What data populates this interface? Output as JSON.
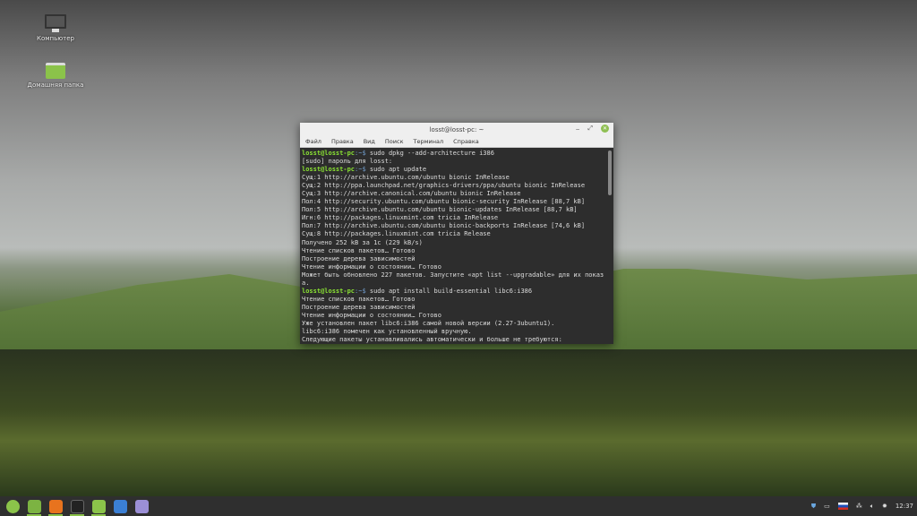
{
  "desktop": {
    "icons": [
      {
        "label": "Компьютер",
        "icon": "computer-icon"
      },
      {
        "label": "Домашняя папка",
        "icon": "home-folder-icon"
      }
    ]
  },
  "terminal": {
    "title": "losst@losst-pc: ~",
    "menu": [
      "Файл",
      "Правка",
      "Вид",
      "Поиск",
      "Терминал",
      "Справка"
    ],
    "lines": [
      {
        "prompt": "losst@losst-pc",
        "path": ":~$ ",
        "text": "sudo dpkg --add-architecture i386"
      },
      {
        "text": "[sudo] пароль для losst:"
      },
      {
        "prompt": "losst@losst-pc",
        "path": ":~$ ",
        "text": "sudo apt update"
      },
      {
        "text": "Сущ:1 http://archive.ubuntu.com/ubuntu bionic InRelease"
      },
      {
        "text": "Сущ:2 http://ppa.launchpad.net/graphics-drivers/ppa/ubuntu bionic InRelease"
      },
      {
        "text": "Сущ:3 http://archive.canonical.com/ubuntu bionic InRelease"
      },
      {
        "text": "Пол:4 http://security.ubuntu.com/ubuntu bionic-security InRelease [88,7 kB]"
      },
      {
        "text": "Пол:5 http://archive.ubuntu.com/ubuntu bionic-updates InRelease [88,7 kB]"
      },
      {
        "text": "Игн:6 http://packages.linuxmint.com tricia InRelease"
      },
      {
        "text": "Пол:7 http://archive.ubuntu.com/ubuntu bionic-backports InRelease [74,6 kB]"
      },
      {
        "text": "Сущ:8 http://packages.linuxmint.com tricia Release"
      },
      {
        "text": "Получено 252 kB за 1с (229 kB/s)"
      },
      {
        "text": "Чтение списков пакетов… Готово"
      },
      {
        "text": "Построение дерева зависимостей"
      },
      {
        "text": "Чтение информации о состоянии… Готово"
      },
      {
        "text": "Может быть обновлено 227 пакетов. Запустите «apt list --upgradable» для их показ"
      },
      {
        "text": "а."
      },
      {
        "prompt": "losst@losst-pc",
        "path": ":~$ ",
        "text": "sudo apt install build-essential libc6:i386"
      },
      {
        "text": "Чтение списков пакетов… Готово"
      },
      {
        "text": "Построение дерева зависимостей"
      },
      {
        "text": "Чтение информации о состоянии… Готово"
      },
      {
        "text": "Уже установлен пакет libc6:i386 самой новой версии (2.27-3ubuntu1)."
      },
      {
        "text": "libc6:i386 помечен как установленный вручную."
      },
      {
        "text": "Следующие пакеты устанавливались автоматически и больше не требуются:"
      }
    ]
  },
  "taskbar": {
    "apps": [
      {
        "name": "mint-menu",
        "color": "#8bc34a"
      },
      {
        "name": "show-desktop",
        "color": "#7cb342"
      },
      {
        "name": "firefox",
        "color": "#e8731e"
      },
      {
        "name": "terminal",
        "color": "#222222"
      },
      {
        "name": "files",
        "color": "#8bc34a"
      },
      {
        "name": "screenshot",
        "color": "#3b7fd4"
      },
      {
        "name": "text-editor",
        "color": "#9b8fd6"
      }
    ],
    "clock": "12:37"
  }
}
